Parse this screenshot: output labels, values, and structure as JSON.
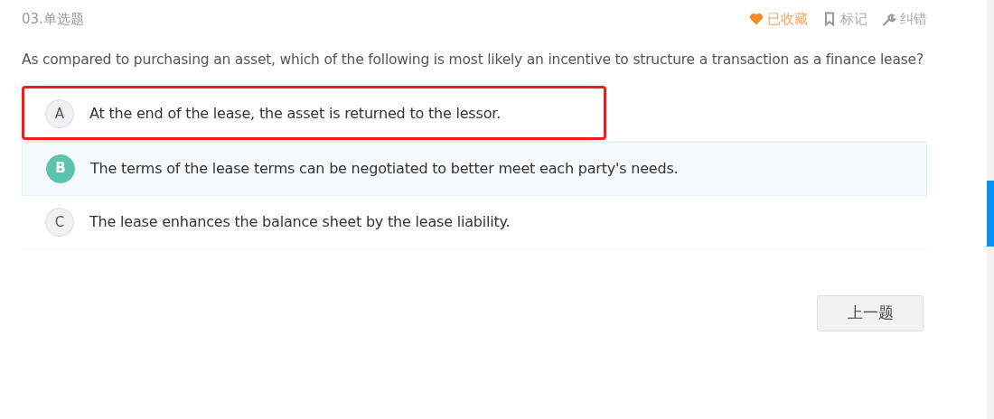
{
  "question": {
    "number": "03.单选题",
    "text": "As compared to purchasing an asset, which of the following is most likely an incentive to structure a transaction as a finance lease?"
  },
  "actions": [
    {
      "kind": "favorite",
      "label": "已收藏",
      "on": true
    },
    {
      "kind": "mark",
      "label": "标记",
      "on": false
    },
    {
      "kind": "report",
      "label": "纠错",
      "on": false
    }
  ],
  "options": [
    {
      "letter": "A",
      "text": "At the end of the lease, the asset is returned to the lessor.",
      "selected": false,
      "highlighted": true
    },
    {
      "letter": "B",
      "text": "The terms of the lease terms can be negotiated to better meet each party's needs.",
      "selected": true,
      "highlighted": false
    },
    {
      "letter": "C",
      "text": "The lease enhances the balance sheet by the lease liability.",
      "selected": false,
      "highlighted": false
    }
  ],
  "buttons": [
    {
      "label": "上一题"
    }
  ]
}
